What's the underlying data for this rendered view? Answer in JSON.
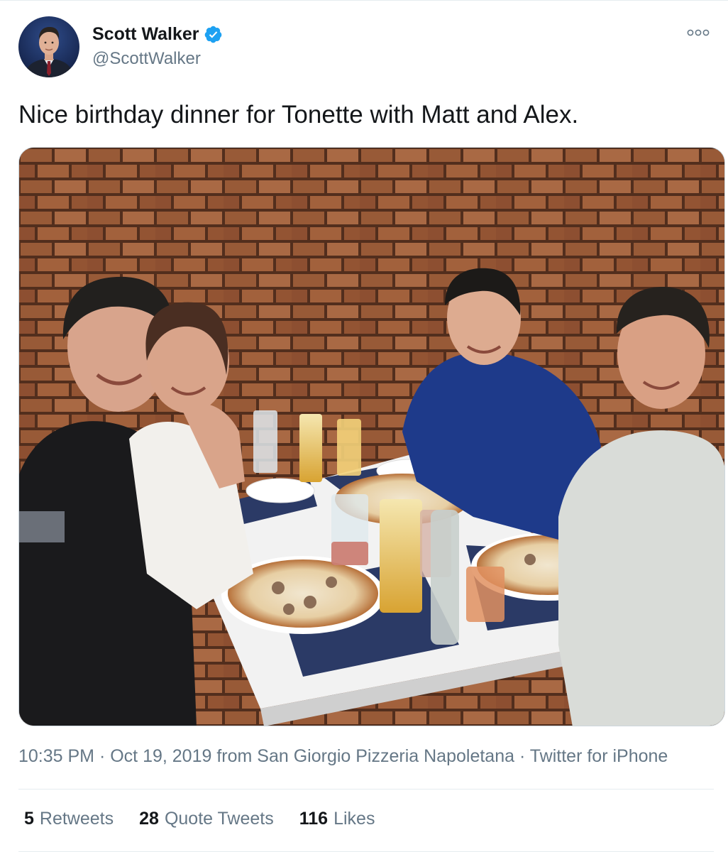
{
  "user": {
    "display_name": "Scott Walker",
    "handle": "@ScottWalker",
    "verified": true,
    "avatar_icon": "profile-photo-avatar"
  },
  "menu": {
    "icon": "more-options-icon"
  },
  "tweet": {
    "text": "Nice birthday dinner for Tonette with Matt and Alex."
  },
  "photo": {
    "subject": "photo-four-people-at-pizza-dinner"
  },
  "meta": {
    "time": "10:35 PM",
    "sep1": " · ",
    "date": "Oct 19, 2019",
    "from_prefix": " from ",
    "location": "San Giorgio Pizzeria Napoletana",
    "sep2": " · ",
    "source": "Twitter for iPhone"
  },
  "stats": {
    "retweets": {
      "count": "5",
      "label": "Retweets"
    },
    "quote_tweets": {
      "count": "28",
      "label": "Quote Tweets"
    },
    "likes": {
      "count": "116",
      "label": "Likes"
    }
  },
  "colors": {
    "verified_blue": "#1da1f2",
    "secondary_text": "#657786",
    "primary_text": "#14171a",
    "divider": "#e6ecf0"
  }
}
